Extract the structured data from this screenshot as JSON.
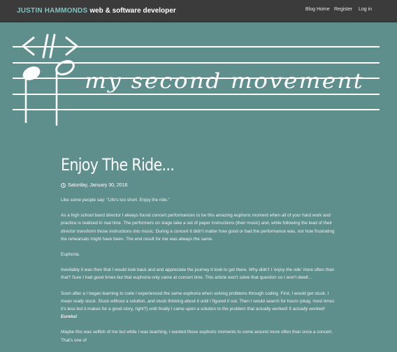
{
  "navbar": {
    "brand_name": "JUSTIN HAMMONDS",
    "brand_tagline": "web & software developer",
    "links": [
      "Blog Home",
      "Register",
      "Log in"
    ]
  },
  "banner": {
    "title": "my second movement"
  },
  "post": {
    "title": "Enjoy The Ride...",
    "date": "Saturday, January 30, 2016",
    "p1": "Like some people say: \"Life's too short. Enjoy the ride.\"",
    "p2": "As a high school band director I always found concert performances to be this amazing euphoric moment when all of your hard work and practice is realized in real time. The performers on stage take a set of paper instructions (their music) and, while following the lead of their director transform those instructions into music. During a concert it didn't matter how good or bad the performance was, nor how frustrating the rehearsals might have been. The end result for me was always the same.",
    "p3": "Euphoria.",
    "p4_before": "Inevitably it was then that I would look back and and appreciate the journey it took to get there. Why didn't I ",
    "p4_em": "'enjoy the ride'",
    "p4_after": " more often than that? Sure I had good times but that euphoria only came at concert time. This article won't solve that question so I won't dwell...",
    "p5_a": "Soon after a I began learning to code I experienced the same euphoria when solving problems through coding. First, I would get stuck. I mean ",
    "p5_em1": "really",
    "p5_b": " stuck. Stuck without a solution, and stuck thinking about it until I figured it out. Then I would search for hours (okay, most times it's less but it makes for a good story, right?) until finally I came upon a solution to the problem that actually worked! It ",
    "p5_em2": "actually worked!",
    "p5_c": " ",
    "p5_strong": "Eureka!",
    "p6": "Maybe this was selfish of me but while I was teaching, I wanted those euphoric moments to come around more often than once a concert. That's one of"
  },
  "colors": {
    "background": "#5e8f8d",
    "navbar": "#3b3b3b",
    "brand_accent": "#7ec4c1"
  },
  "icons": [
    "clock-icon",
    "treble-clef-icon",
    "quarter-note-icon",
    "half-note-icon",
    "repeat-bracket-icon"
  ]
}
